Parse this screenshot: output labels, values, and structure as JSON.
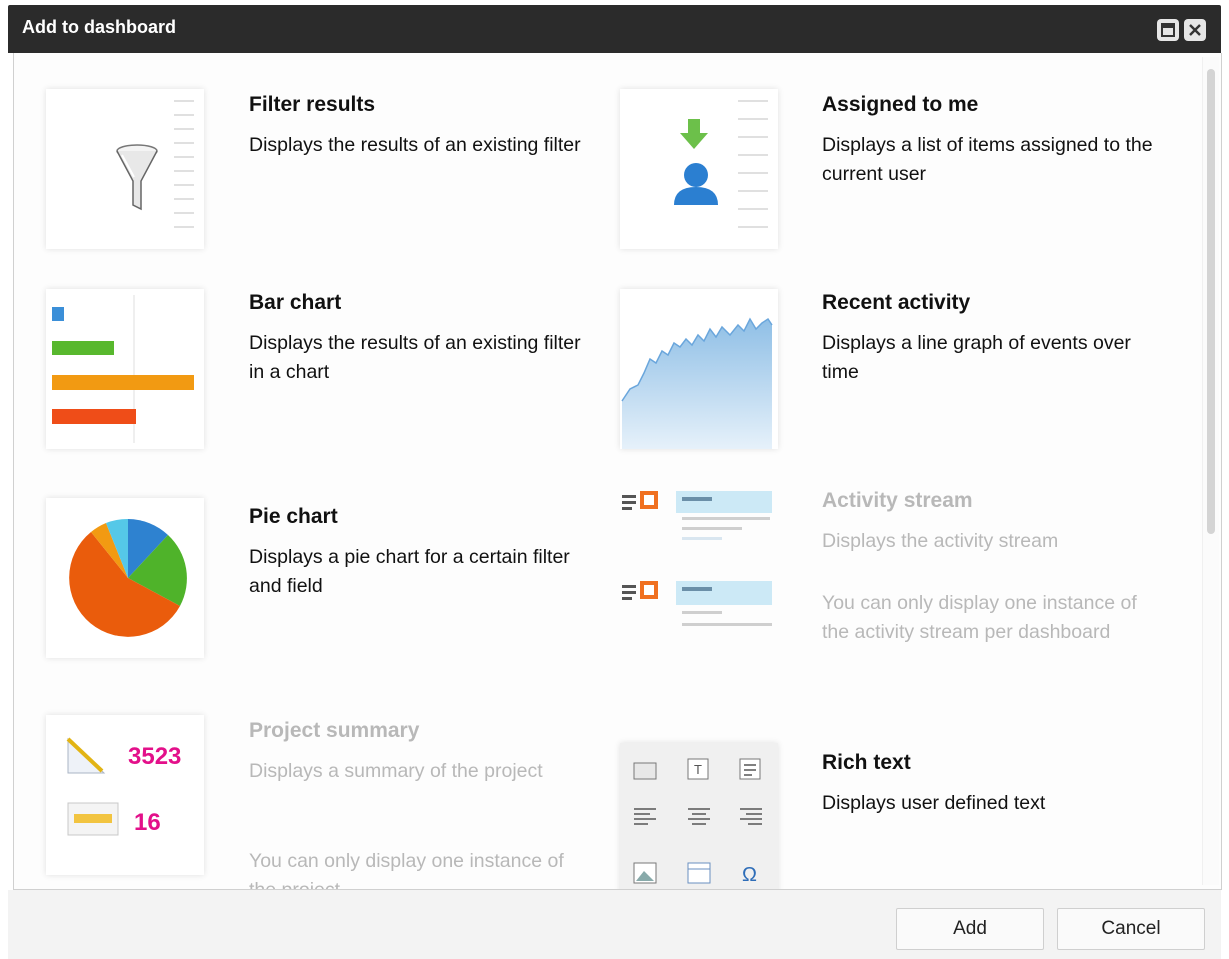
{
  "dialog": {
    "title": "Add to dashboard"
  },
  "gadgets": [
    {
      "title": "Filter results",
      "description": "Displays the results of an existing filter",
      "icon": "funnel-icon",
      "enabled": true
    },
    {
      "title": "Assigned to me",
      "description": "Displays a list of items assigned to the current user",
      "icon": "user-assigned-icon",
      "enabled": true
    },
    {
      "title": "Bar chart",
      "description": "Displays the results of an existing filter in a chart",
      "icon": "bar-chart-icon",
      "enabled": true
    },
    {
      "title": "Recent activity",
      "description": "Displays a line graph of events over time",
      "icon": "line-graph-icon",
      "enabled": true
    },
    {
      "title": "Pie chart",
      "description": "Displays a pie chart for a certain filter and field",
      "icon": "pie-chart-icon",
      "enabled": true
    },
    {
      "title": "Activity stream",
      "description": "Displays the activity stream",
      "note": "You can only display one instance of the activity stream per dashboard",
      "icon": "activity-stream-icon",
      "enabled": false
    },
    {
      "title": "Project summary",
      "description": "Displays a summary of the project",
      "note": "You can only display one instance of the project",
      "icon": "project-summary-icon",
      "enabled": false,
      "stats": [
        "3523",
        "16"
      ]
    },
    {
      "title": "Rich text",
      "description": "Displays user defined text",
      "icon": "rich-text-icon",
      "enabled": true
    }
  ],
  "buttons": {
    "add": "Add",
    "cancel": "Cancel"
  },
  "colors": {
    "titlebar": "#2b2b2b",
    "stat_pink": "#e3108a"
  }
}
